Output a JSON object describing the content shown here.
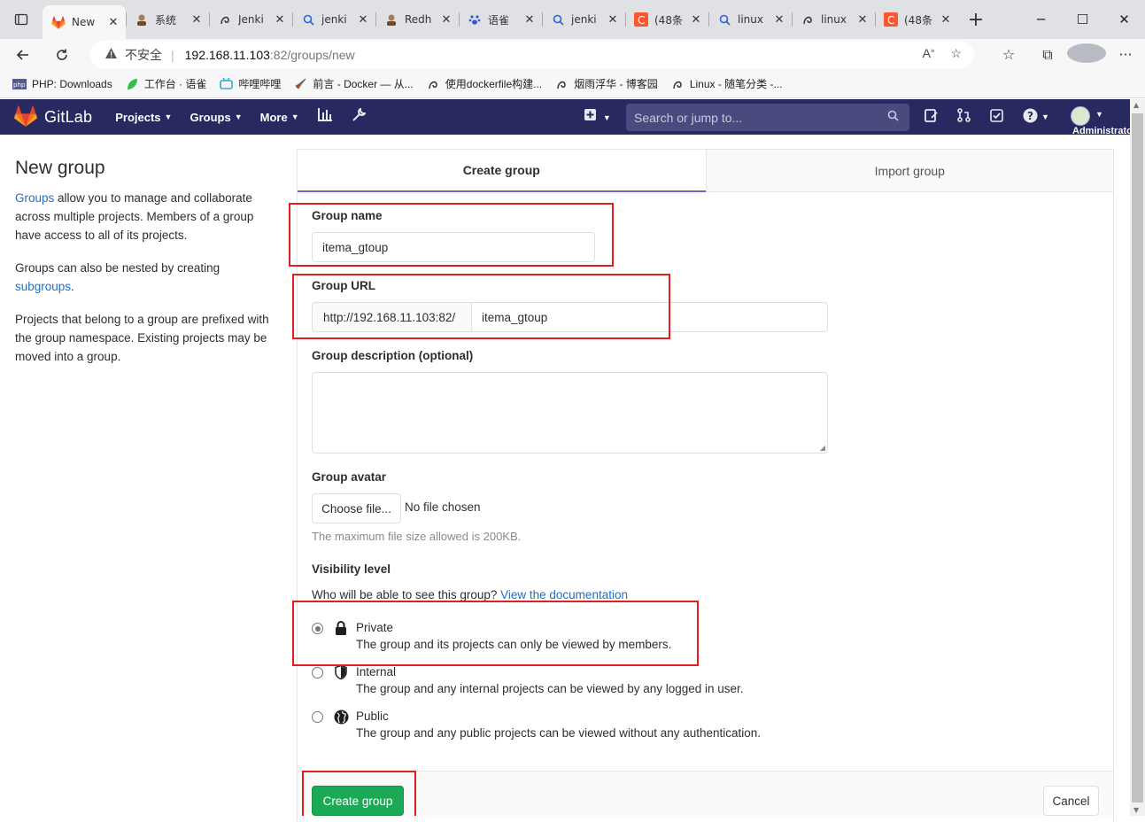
{
  "browser": {
    "tabs": [
      {
        "title": "New",
        "icon": "gitlab-icon",
        "active": true
      },
      {
        "title": "系统",
        "icon": "avatar-icon"
      },
      {
        "title": "Jenki",
        "icon": "swirl-icon"
      },
      {
        "title": "jenki",
        "icon": "search-icon"
      },
      {
        "title": "Redh",
        "icon": "avatar-icon"
      },
      {
        "title": "语雀",
        "icon": "paw-icon"
      },
      {
        "title": "jenki",
        "icon": "search-icon"
      },
      {
        "title": "(48条",
        "icon": "c-icon"
      },
      {
        "title": "linux",
        "icon": "search-icon"
      },
      {
        "title": "linux",
        "icon": "swirl-icon"
      },
      {
        "title": "(48条",
        "icon": "c-icon"
      }
    ],
    "security_label": "不安全",
    "url_host": "192.168.11.103",
    "url_path": ":82/groups/new",
    "bookmarks": [
      {
        "label": "PHP: Downloads"
      },
      {
        "label": "工作台 · 语雀"
      },
      {
        "label": "哔哩哔哩"
      },
      {
        "label": "前言 - Docker — 从..."
      },
      {
        "label": "使用dockerfile构建..."
      },
      {
        "label": "烟雨浮华 - 博客园"
      },
      {
        "label": "Linux - 随笔分类 -..."
      }
    ]
  },
  "gitlab_nav": {
    "brand": "GitLab",
    "menu": [
      "Projects",
      "Groups",
      "More"
    ],
    "search_placeholder": "Search or jump to...",
    "user_name": "Administrator"
  },
  "sidebar": {
    "title": "New group",
    "para1_link": "Groups",
    "para1_text": " allow you to manage and collaborate across multiple projects. Members of a group have access to all of its projects.",
    "para2_text": "Groups can also be nested by creating ",
    "para2_link": "subgroups",
    "para2_end": ".",
    "para3_text": "Projects that belong to a group are prefixed with the group namespace. Existing projects may be moved into a group."
  },
  "tabs": {
    "create": "Create group",
    "import": "Import group"
  },
  "form": {
    "group_name_label": "Group name",
    "group_name_value": "itema_gtoup",
    "group_url_label": "Group URL",
    "group_url_prefix": "http://192.168.11.103:82/",
    "group_url_value": "itema_gtoup",
    "description_label": "Group description (optional)",
    "avatar_label": "Group avatar",
    "choose_file": "Choose file...",
    "no_file": "No file chosen",
    "max_size_note": "The maximum file size allowed is 200KB.",
    "visibility_label": "Visibility level",
    "visibility_question": "Who will be able to see this group? ",
    "visibility_link": "View the documentation",
    "visibility_options": [
      {
        "title": "Private",
        "desc": "The group and its projects can only be viewed by members.",
        "icon": "lock-icon",
        "checked": true
      },
      {
        "title": "Internal",
        "desc": "The group and any internal projects can be viewed by any logged in user.",
        "icon": "shield-icon",
        "checked": false
      },
      {
        "title": "Public",
        "desc": "The group and any public projects can be viewed without any authentication.",
        "icon": "globe-icon",
        "checked": false
      }
    ],
    "create_button": "Create group",
    "cancel_button": "Cancel"
  },
  "colors": {
    "gitlab_nav": "#292961",
    "create_button": "#1aaa55",
    "link": "#1f6fc6",
    "highlight": "#e02020"
  }
}
